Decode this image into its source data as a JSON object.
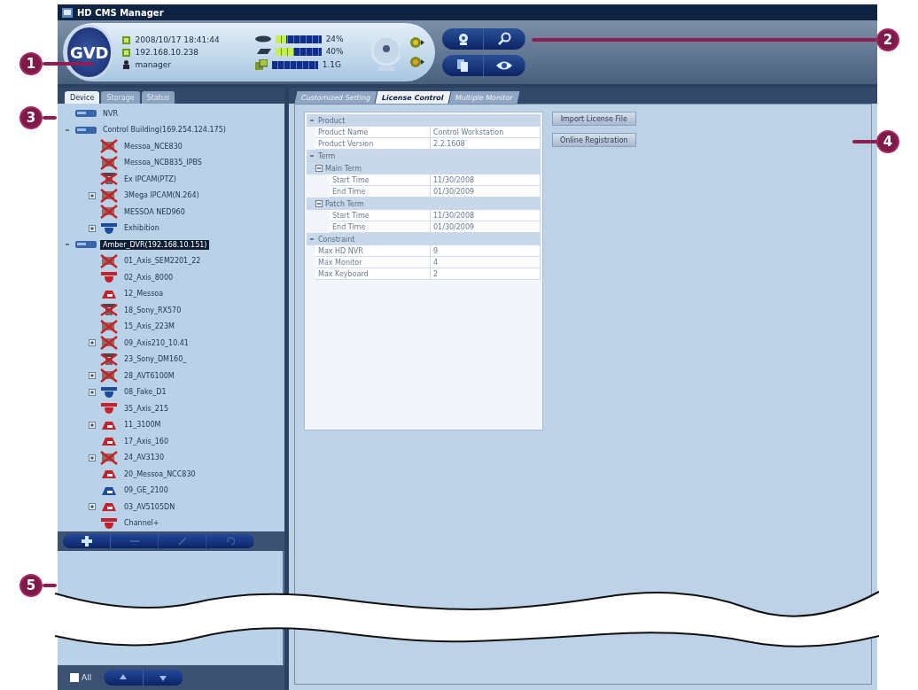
{
  "window": {
    "title": "HD CMS Manager"
  },
  "header": {
    "logo": "GVD",
    "date_time": "2008/10/17  18:41:44",
    "ip": "192.168.10.238",
    "user": "manager",
    "meters": [
      {
        "kind": "disk",
        "level": 0.24,
        "reading": "24%"
      },
      {
        "kind": "network",
        "level": 0.4,
        "reading": "40%"
      },
      {
        "kind": "memory",
        "reading": "1.1G"
      }
    ]
  },
  "left_panel": {
    "tabs": [
      {
        "label": "Device",
        "selected": true
      },
      {
        "label": "Storage",
        "selected": false
      },
      {
        "label": "Status",
        "selected": false
      }
    ],
    "tree": [
      {
        "label": "NVR",
        "kind": "recorder",
        "selected": false
      },
      {
        "label": "Control Building(169.254.124.175)",
        "kind": "recorder",
        "selected": false,
        "expanded": true,
        "children": [
          {
            "label": "Messoa_NCE830",
            "kind": "camera-off",
            "selected": false
          },
          {
            "label": "Messoa_NCB835_IPBS",
            "kind": "camera-off",
            "selected": false
          },
          {
            "label": "Ex IPCAM(PTZ)",
            "kind": "ptz-off",
            "selected": false
          },
          {
            "label": "3Mega IPCAM(N.264)",
            "kind": "camera-off",
            "selected": false,
            "expanded": false
          },
          {
            "label": "MESSOA NED960",
            "kind": "camera-off",
            "selected": false
          },
          {
            "label": "Exhibition",
            "kind": "dome-blue",
            "selected": false,
            "expanded": false
          }
        ]
      },
      {
        "label": "Amber_DVR(192.168.10.151)",
        "kind": "recorder",
        "selected": true,
        "expanded": true,
        "children": [
          {
            "label": "01_Axis_SEM2201_22",
            "kind": "camera-off",
            "selected": false
          },
          {
            "label": "02_Axis_8000",
            "kind": "dome-red",
            "selected": false
          },
          {
            "label": "12_Messoa",
            "kind": "box-red",
            "selected": false
          },
          {
            "label": "18_Sony_RX570",
            "kind": "ptz-off",
            "selected": false
          },
          {
            "label": "15_Axis_223M",
            "kind": "camera-off",
            "selected": false
          },
          {
            "label": "09_Axis210_10.41",
            "kind": "camera-off",
            "selected": false,
            "expanded": false
          },
          {
            "label": "23_Sony_DM160_",
            "kind": "ptz-off",
            "selected": false
          },
          {
            "label": "28_AVT6100M",
            "kind": "camera-off",
            "selected": false,
            "expanded": false
          },
          {
            "label": "08_Fake_D1",
            "kind": "dome-blue",
            "selected": false,
            "expanded": false
          },
          {
            "label": "35_Axis_215",
            "kind": "dome-red",
            "selected": false
          },
          {
            "label": "11_3100M",
            "kind": "box-red",
            "selected": false,
            "expanded": false
          },
          {
            "label": "17_Axis_160",
            "kind": "box-red",
            "selected": false
          },
          {
            "label": "24_AV3130",
            "kind": "camera-off",
            "selected": false,
            "expanded": false
          },
          {
            "label": "20_Messoa_NCC830",
            "kind": "box-red",
            "selected": false
          },
          {
            "label": "09_GE_2100",
            "kind": "box-blue",
            "selected": false
          },
          {
            "label": "03_AV5105DN",
            "kind": "box-red",
            "selected": false,
            "expanded": false
          },
          {
            "label": "Channel+",
            "kind": "dome-red",
            "selected": false
          }
        ]
      }
    ],
    "toolbar": [
      {
        "kind": "add",
        "disabled": false
      },
      {
        "kind": "remove",
        "disabled": true
      },
      {
        "kind": "edit",
        "disabled": true
      },
      {
        "kind": "undo",
        "disabled": true
      }
    ],
    "all_checkbox": {
      "label": "All",
      "checked": false
    }
  },
  "main_panel": {
    "tabs": [
      {
        "label": "Customized Setting",
        "selected": false
      },
      {
        "label": "License Control",
        "selected": true
      },
      {
        "label": "Multiple Monitor",
        "selected": false
      }
    ],
    "sections": [
      {
        "title": "Product",
        "expanded": true,
        "rows": [
          {
            "name": "Product Name",
            "value": "Control Workstation"
          },
          {
            "name": "Product Version",
            "value": "2.2.1608"
          }
        ]
      },
      {
        "title": "Term",
        "expanded": true,
        "groups": [
          {
            "title": "Main Term",
            "expanded": true,
            "rows": [
              {
                "name": "Start Time",
                "value": "11/30/2008"
              },
              {
                "name": "End Time",
                "value": "01/30/2009"
              }
            ]
          },
          {
            "title": "Patch Term",
            "expanded": true,
            "rows": [
              {
                "name": "Start Time",
                "value": "11/30/2008"
              },
              {
                "name": "End Time",
                "value": "01/30/2009"
              }
            ]
          }
        ]
      },
      {
        "title": "Constraint",
        "expanded": true,
        "rows": [
          {
            "name": "Max HD NVR",
            "value": "9"
          },
          {
            "name": "Max Monitor",
            "value": "4"
          },
          {
            "name": "Max Keyboard",
            "value": "2"
          }
        ]
      }
    ],
    "buttons": [
      "Import License File",
      "Online Registration"
    ]
  },
  "callouts": [
    {
      "number": "1",
      "kind": "left"
    },
    {
      "number": "2",
      "kind": "right"
    },
    {
      "number": "3",
      "kind": "left"
    },
    {
      "number": "4",
      "kind": "right"
    },
    {
      "number": "5",
      "kind": "left"
    }
  ]
}
